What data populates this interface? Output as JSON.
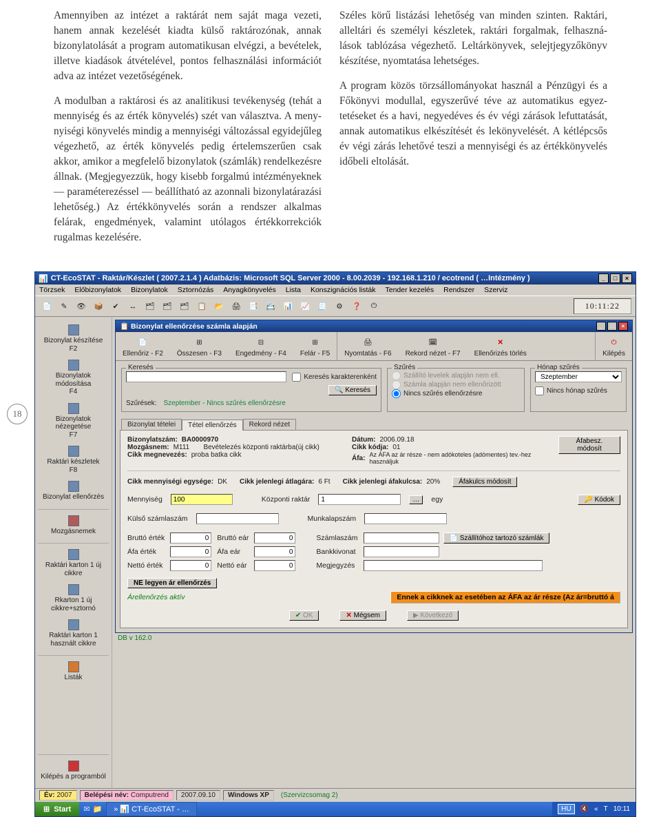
{
  "page_number": "18",
  "text": {
    "col1_p1": "Amennyiben az intézet a raktárát nem saját maga vezeti, hanem annak kezelését kiadta külső raktározónak, annak bizonylatolását a program automatikusan elvégzi, a bevéte­lek, illetve kiadások átvételével, pontos felhasználási infor­mációt adva az intézet vezetőségének.",
    "col1_p2": "A modulban a raktárosi és az analitikusi tevékenység (tehát a mennyiség és az érték könyvelés) szét van választva. A meny­nyiségi könyvelés mindig a mennyiségi változással egyide­jűleg végezhető, az érték könyvelés pedig értelemszerűen csak akkor, amikor a megfelelő bizonylatok (számlák) ren­delkezésre állnak. (Megjegyezzük, hogy kisebb forgalmú intézményeknek — paraméterezéssel — beállítható az azon­nali bizonylatárazási lehetőség.) Az értékkönyvelés során a rendszer alkalmas felárak, engedmények, valamint utólagos értékkorrekciók rugalmas kezelésére.",
    "col2_p1": "Széles körű listázási lehetőség van minden szinten. Raktári, alleltári és személyi készletek, raktári forgalmak, felhaszná­lások tablózása végezhető. Leltárkönyvek, selejtjegyzőkönyv készítése, nyomtatása lehetséges.",
    "col2_p2": "A program közös törzsállományokat használ a Pénzügyi és a Főkönyvi modullal, egyszerűvé téve az automatikus egyez­tetéseket és a havi, negyedéves és év végi zárások lefutta­tását, annak automatikus elkészítését és lekönyvelését. A kétlépcsős év végi zárás lehetővé teszi a mennyiségi és az értékkönyvelés időbeli eltolását."
  },
  "app": {
    "title": "CT-EcoSTAT - Raktár/Készlet ( 2007.2.1.4 ) Adatbázis: Microsoft SQL Server 2000 - 8.00.2039 - 192.168.1.210 / ecotrend  ( …Intézmény )",
    "menus": [
      "Törzsek",
      "Előbizonylatok",
      "Bizonylatok",
      "Sztornózás",
      "Anyagkönyvelés",
      "Lista",
      "Konszignációs listák",
      "Tender kezelés",
      "Rendszer",
      "Szerviz"
    ],
    "clock": "10:11:22",
    "sidebar": [
      {
        "label": "Bizonylat készítése",
        "hot": "F2"
      },
      {
        "label": "Bizonylatok módosítása",
        "hot": "F4"
      },
      {
        "label": "Bizonylatok nézegetése",
        "hot": "F7"
      },
      {
        "label": "Raktári készletek",
        "hot": "F8"
      },
      {
        "label": "Bizonylat ellenőrzés",
        "hot": ""
      },
      {
        "label": "Mozgásnemek",
        "hot": ""
      },
      {
        "label": "Raktári karton 1 új cikkre",
        "hot": ""
      },
      {
        "label": "Rkarton 1 új cikkre+sztornó",
        "hot": ""
      },
      {
        "label": "Raktári karton 1 használt cikkre",
        "hot": ""
      },
      {
        "label": "Listák",
        "hot": ""
      },
      {
        "label": "Kilépés a programból",
        "hot": ""
      }
    ],
    "db_version": "DB v 162.0",
    "status": {
      "year_label": "Év:",
      "year": "2007",
      "login_label": "Belépési név:",
      "login": "Computrend",
      "date": "2007.09.10",
      "os": "Windows XP",
      "sp": "(Szervizcsomag 2)"
    }
  },
  "dialog": {
    "title": "Bizonylat ellenőrzése számla alapján",
    "toolbar": [
      {
        "label": "Ellenőriz - F2"
      },
      {
        "label": "Összesen - F3"
      },
      {
        "label": "Engedmény - F4"
      },
      {
        "label": "Felár - F5"
      },
      {
        "label": "Nyomtatás - F6"
      },
      {
        "label": "Rekord nézet - F7"
      },
      {
        "label": "Ellenőrizés törlés"
      },
      {
        "label": "Kilépés"
      }
    ],
    "search": {
      "group": "Keresés",
      "charwise": "Keresés karakterenként",
      "btn": "Keresés",
      "filters_label": "Szűrések:",
      "filters_value": "Szeptember - Nincs szűrés ellenőrzésre"
    },
    "filter": {
      "group": "Szűrés",
      "opt1": "Szállító levelek alapján nem ell.",
      "opt2": "Számla alapján nem ellenőrizött",
      "opt3": "Nincs szűrés ellenőrzésre"
    },
    "monthfilter": {
      "group": "Hónap szűrés",
      "value": "Szeptember",
      "none": "Nincs hónap szűrés"
    },
    "tabs": [
      "Bizonylat tételei",
      "Tétel ellenőrzés",
      "Rekord nézet"
    ],
    "active_tab": 1,
    "details": {
      "bizszam_k": "Bizonylatszám:",
      "bizszam_v": "BA0000970",
      "mozg_k": "Mozgásnem:",
      "mozg_v": "M111",
      "mozg_desc": "Bevételezés központi raktárba(új cikk)",
      "cikk_k": "Cikk megnevezés:",
      "cikk_v": "proba batka cikk",
      "datum_k": "Dátum:",
      "datum_v": "2006.09.18",
      "cikkkod_k": "Cikk kódja:",
      "cikkkod_v": "01",
      "afa_k": "Áfa:",
      "afa_v": "Az ÁFA az ár része - nem adókoteles (adómentes) tev.-hez használjuk",
      "afamod_btn": "Áfabesz. módosít",
      "menny_egyk": "Cikk mennyiségi egysége:",
      "menny_egyv": "DK",
      "atlag_k": "Cikk jelenlegi átlagára:",
      "atlag_v": "6 Ft",
      "afakulcs_k": "Cikk jelenlegi áfakulcsa:",
      "afakulcs_v": "20%",
      "afakulcs_btn": "Áfakulcs módosít",
      "menny_k": "Mennyiség",
      "menny_v": "100",
      "raktar_k": "Központi raktár",
      "raktar_v": "1",
      "raktar_u": "egy",
      "kodok_btn": "Kódok",
      "kulso_k": "Külső számlaszám",
      "munka_k": "Munkalapszám",
      "brutto_ertek": "Bruttó érték",
      "afa_ertek": "Áfa érték",
      "netto_ertek": "Nettó érték",
      "brutto_ear": "Bruttó eár",
      "afa_ear": "Áfa eár",
      "netto_ear": "Nettó eár",
      "zero": "0",
      "szamlaszam": "Számlaszám",
      "szallito_btn": "Szállítóhoz tartozó számlák",
      "bankkivonat": "Bankkivonat",
      "megjegyzes": "Megjegyzés",
      "ne_legyen": "NE legyen ár ellenőrzés",
      "arellen": "Árellenőrzés aktív",
      "footer_msg": "Ennek a cikknek az esetében az ÁFA az ár része (Az ár=bruttó á"
    },
    "actions": {
      "ok": "OK",
      "cancel": "Mégsem",
      "next": "Következő"
    }
  },
  "taskbar": {
    "start": "Start",
    "task": "CT-EcoSTAT - …",
    "lang": "HU",
    "time": "10:11"
  }
}
